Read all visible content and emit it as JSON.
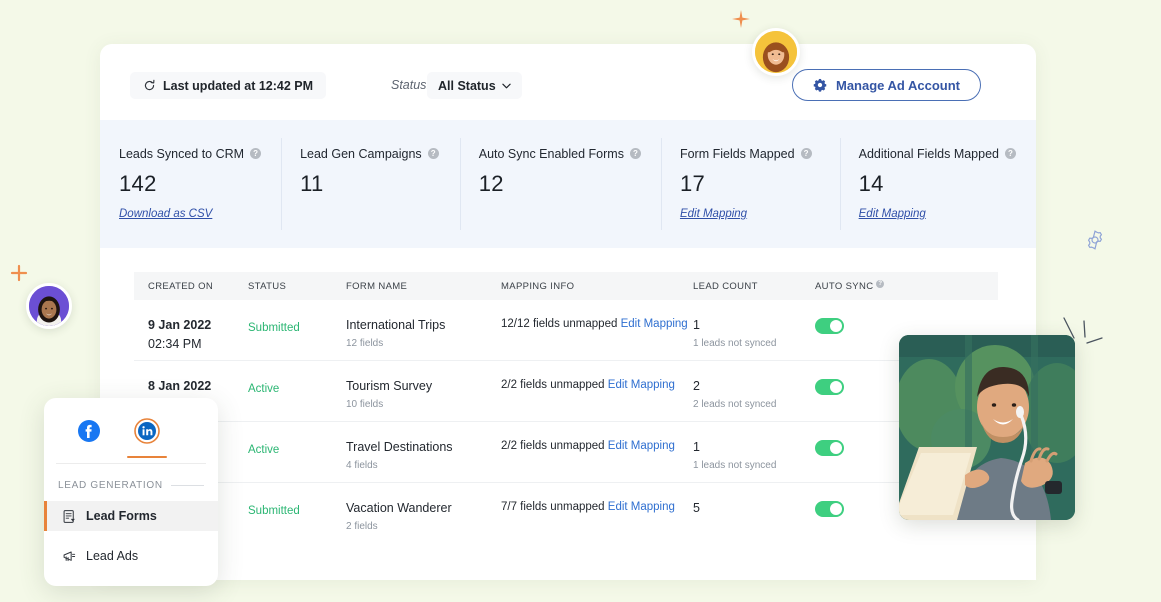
{
  "toolbar": {
    "refresh_icon": "refresh-icon",
    "last_updated": "Last updated at 12:42 PM",
    "status_label": "Status:",
    "status_value": "All Status",
    "chevron": "⌄",
    "manage_button": "Manage Ad Account",
    "gear_icon": "gear-icon"
  },
  "stats": [
    {
      "title": "Leads Synced to CRM",
      "value": "142",
      "link": "Download as CSV",
      "help": "?"
    },
    {
      "title": "Lead Gen Campaigns",
      "value": "11",
      "link": "",
      "help": "?"
    },
    {
      "title": "Auto Sync Enabled Forms",
      "value": "12",
      "link": "",
      "help": "?"
    },
    {
      "title": "Form Fields Mapped",
      "value": "17",
      "link": "Edit Mapping",
      "help": "?"
    },
    {
      "title": "Additional Fields Mapped",
      "value": "14",
      "link": "Edit Mapping",
      "help": "?"
    }
  ],
  "table": {
    "columns": [
      {
        "label": "Created On",
        "help": ""
      },
      {
        "label": "Status",
        "help": ""
      },
      {
        "label": "Form Name",
        "help": ""
      },
      {
        "label": "Mapping Info",
        "help": ""
      },
      {
        "label": "Lead Count",
        "help": ""
      },
      {
        "label": "Auto Sync",
        "help": "?"
      }
    ],
    "rows": [
      {
        "date": "9 Jan 2022",
        "time": "02:34 PM",
        "status": "Submitted",
        "form_name": "International Trips",
        "fields": "12 fields",
        "mapping_text": "12/12 fields unmapped",
        "mapping_link": "Edit Mapping",
        "lead_count": "1",
        "lead_note": "1 leads not synced",
        "auto_sync": "on"
      },
      {
        "date": "8 Jan 2022",
        "time": "",
        "status": "Active",
        "form_name": "Tourism Survey",
        "fields": "10 fields",
        "mapping_text": "2/2 fields unmapped",
        "mapping_link": "Edit Mapping",
        "lead_count": "2",
        "lead_note": "2 leads not synced",
        "auto_sync": "on"
      },
      {
        "date": "",
        "time": "",
        "status": "Active",
        "form_name": "Travel Destinations",
        "fields": "4 fields",
        "mapping_text": "2/2 fields unmapped",
        "mapping_link": "Edit Mapping",
        "lead_count": "1",
        "lead_note": "1 leads not synced",
        "auto_sync": "on"
      },
      {
        "date": "",
        "time": "",
        "status": "Submitted",
        "form_name": "Vacation Wanderer",
        "fields": "2 fields",
        "mapping_text": "7/7 fields unmapped",
        "mapping_link": "Edit Mapping",
        "lead_count": "5",
        "lead_note": "",
        "auto_sync": "on"
      }
    ]
  },
  "side_panel": {
    "tabs": [
      {
        "name": "facebook-tab",
        "icon": "facebook-icon",
        "selected": false
      },
      {
        "name": "linkedin-tab",
        "icon": "linkedin-icon",
        "selected": true
      }
    ],
    "section_label": "LEAD GENERATION",
    "items": [
      {
        "label": "Lead Forms",
        "icon": "form-icon",
        "active": true
      },
      {
        "label": "Lead Ads",
        "icon": "megaphone-icon",
        "active": false
      }
    ]
  },
  "decor": {
    "sparkle_top": "sparkle-icon",
    "plus_left": "plus-icon",
    "gear_right": "gear-outline-icon",
    "avatar_top": "avatar",
    "avatar_left": "avatar",
    "video": "video-thumbnail"
  },
  "colors": {
    "page_bg": "#f4f9e8",
    "card_bg": "#ffffff",
    "stats_bg": "#f2f6fc",
    "accent_blue": "#3455a4",
    "accent_orange": "#e8833a",
    "status_green": "#2bb673",
    "toggle_green": "#3ecf80",
    "link_blue": "#2f6fd0"
  }
}
